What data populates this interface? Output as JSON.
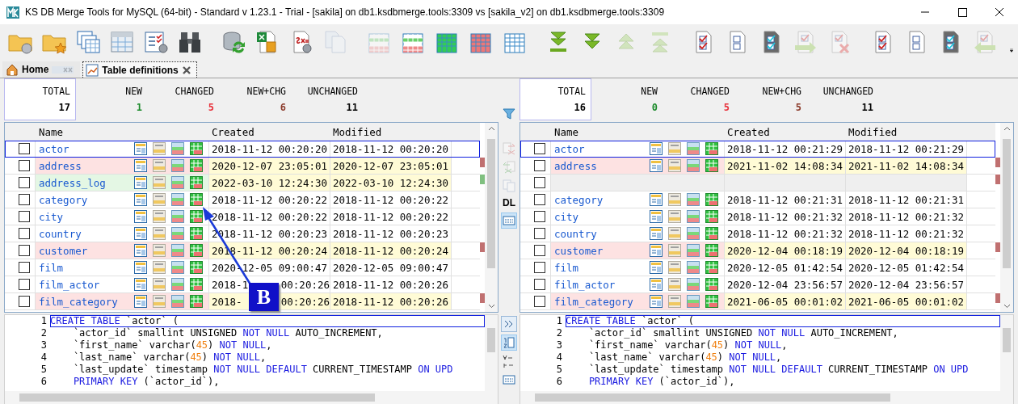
{
  "window": {
    "title": "KS DB Merge Tools for MySQL (64-bit) - Standard v 1.23.1 - Trial - [sakila] on db1.ksdbmerge.tools:3309 vs [sakila_v2] on db1.ksdbmerge.tools:3309"
  },
  "toolbar": [
    {
      "kind": "folder",
      "disabled": false
    },
    {
      "kind": "folder-star",
      "disabled": false
    },
    {
      "kind": "tables",
      "disabled": false
    },
    {
      "kind": "select-table",
      "disabled": false
    },
    {
      "kind": "checklist",
      "disabled": false
    },
    {
      "kind": "binoculars",
      "disabled": false
    },
    {
      "kind": "separator"
    },
    {
      "kind": "db-sync",
      "disabled": false
    },
    {
      "kind": "excel-doc",
      "disabled": false
    },
    {
      "kind": "script-doc",
      "disabled": false
    },
    {
      "kind": "copy-doc",
      "disabled": true
    },
    {
      "kind": "separator"
    },
    {
      "kind": "grid-mixed",
      "disabled": true
    },
    {
      "kind": "grid-mixed",
      "disabled": false
    },
    {
      "kind": "grid",
      "color": "#33cc55",
      "disabled": false
    },
    {
      "kind": "grid",
      "color": "#ee7777",
      "disabled": false
    },
    {
      "kind": "grid",
      "color": "#ffffff",
      "disabled": false
    },
    {
      "kind": "separator"
    },
    {
      "kind": "arrows-down-bar",
      "disabled": false
    },
    {
      "kind": "arrows-down",
      "disabled": false
    },
    {
      "kind": "arrows-up",
      "disabled": true
    },
    {
      "kind": "arrows-up-bar",
      "disabled": true
    },
    {
      "kind": "separator"
    },
    {
      "kind": "checked-doc",
      "disabled": false
    },
    {
      "kind": "empty-doc",
      "disabled": false
    },
    {
      "kind": "dark-doc",
      "disabled": false
    },
    {
      "kind": "doc-arrow-right",
      "disabled": true
    },
    {
      "kind": "doc-cross",
      "disabled": true
    },
    {
      "kind": "separator"
    },
    {
      "kind": "checked-doc",
      "disabled": false
    },
    {
      "kind": "empty-doc",
      "disabled": false
    },
    {
      "kind": "dark-doc",
      "disabled": false
    },
    {
      "kind": "doc-arrow-left",
      "disabled": true
    },
    {
      "kind": "overflow",
      "disabled": false
    }
  ],
  "tabs": [
    {
      "label": "Home",
      "selected": false
    },
    {
      "label": "Table definitions",
      "selected": true
    }
  ],
  "panels": [
    {
      "summary": [
        {
          "label": "TOTAL",
          "value": "17",
          "color": "#000000",
          "selected": true
        },
        {
          "label": "NEW",
          "value": "1",
          "color": "#1a8a2a",
          "selected": false
        },
        {
          "label": "CHANGED",
          "value": "5",
          "color": "#e8303a",
          "selected": false
        },
        {
          "label": "NEW+CHG",
          "value": "6",
          "color": "#8b3a2a",
          "selected": false
        },
        {
          "label": "UNCHANGED",
          "value": "11",
          "color": "#000000",
          "selected": false
        }
      ],
      "columns": [
        "Name",
        "Created",
        "Modified"
      ],
      "rows": [
        {
          "name": "actor",
          "created": "2018-11-12 00:20:20",
          "modified": "2018-11-12 00:20:20",
          "kind": "unchanged",
          "checked": false,
          "selected": true
        },
        {
          "name": "address",
          "created": "2020-12-07 23:05:01",
          "modified": "2020-12-07 23:05:01",
          "kind": "changed",
          "checked": false,
          "selected": false
        },
        {
          "name": "address_log",
          "created": "2022-03-10 12:24:30",
          "modified": "2022-03-10 12:24:30",
          "kind": "new",
          "checked": false,
          "selected": false
        },
        {
          "name": "category",
          "created": "2018-11-12 00:20:22",
          "modified": "2018-11-12 00:20:22",
          "kind": "unchanged",
          "checked": false,
          "selected": false
        },
        {
          "name": "city",
          "created": "2018-11-12 00:20:22",
          "modified": "2018-11-12 00:20:22",
          "kind": "unchanged",
          "checked": false,
          "selected": false
        },
        {
          "name": "country",
          "created": "2018-11-12 00:20:23",
          "modified": "2018-11-12 00:20:23",
          "kind": "unchanged",
          "checked": false,
          "selected": false
        },
        {
          "name": "customer",
          "created": "2018-11-12 00:20:24",
          "modified": "2018-11-12 00:20:24",
          "kind": "changed",
          "checked": false,
          "selected": false
        },
        {
          "name": "film",
          "created": "2020-12-05 09:00:47",
          "modified": "2020-12-05 09:00:47",
          "kind": "unchanged",
          "checked": false,
          "selected": false
        },
        {
          "name": "film_actor",
          "created": "2018-1",
          "created_tail": "00:20:26",
          "modified": "2018-11-12 00:20:26",
          "kind": "unchanged",
          "checked": false,
          "selected": false
        },
        {
          "name": "film_category",
          "created": "2018-",
          "created_tail": "00:20:26",
          "modified": "2018-11-12 00:20:26",
          "kind": "changed",
          "checked": false,
          "selected": false
        }
      ],
      "editor": {
        "lines": [
          {
            "number": "1",
            "tokens": [
              {
                "kind": "keyword",
                "text": "CREATE TABLE"
              },
              {
                "kind": "plain",
                "text": " `actor` ("
              }
            ]
          },
          {
            "number": "2",
            "tokens": [
              {
                "kind": "plain",
                "text": "    `actor_id` smallint UNSIGNED "
              },
              {
                "kind": "keyword",
                "text": "NOT NULL"
              },
              {
                "kind": "plain",
                "text": " AUTO_INCREMENT,"
              }
            ]
          },
          {
            "number": "3",
            "tokens": [
              {
                "kind": "plain",
                "text": "    `first_name` varchar("
              },
              {
                "kind": "number",
                "text": "45"
              },
              {
                "kind": "plain",
                "text": ") "
              },
              {
                "kind": "keyword",
                "text": "NOT NULL"
              },
              {
                "kind": "plain",
                "text": ","
              }
            ]
          },
          {
            "number": "4",
            "tokens": [
              {
                "kind": "plain",
                "text": "    `last_name` varchar("
              },
              {
                "kind": "number",
                "text": "45"
              },
              {
                "kind": "plain",
                "text": ") "
              },
              {
                "kind": "keyword",
                "text": "NOT NULL"
              },
              {
                "kind": "plain",
                "text": ","
              }
            ]
          },
          {
            "number": "5",
            "tokens": [
              {
                "kind": "plain",
                "text": "    `last_update` timestamp "
              },
              {
                "kind": "keyword",
                "text": "NOT NULL DEFAULT"
              },
              {
                "kind": "plain",
                "text": " CURRENT_TIMESTAMP "
              },
              {
                "kind": "keyword",
                "text": "ON UPD"
              }
            ]
          },
          {
            "number": "6",
            "tokens": [
              {
                "kind": "keyword",
                "text": "    PRIMARY KEY"
              },
              {
                "kind": "plain",
                "text": " (`actor_id`),"
              }
            ]
          }
        ]
      }
    },
    {
      "summary": [
        {
          "label": "TOTAL",
          "value": "16",
          "color": "#000000",
          "selected": true
        },
        {
          "label": "NEW",
          "value": "0",
          "color": "#1a8a2a",
          "selected": false
        },
        {
          "label": "CHANGED",
          "value": "5",
          "color": "#e8303a",
          "selected": false
        },
        {
          "label": "NEW+CHG",
          "value": "5",
          "color": "#8b3a2a",
          "selected": false
        },
        {
          "label": "UNCHANGED",
          "value": "11",
          "color": "#000000",
          "selected": false
        }
      ],
      "columns": [
        "Name",
        "Created",
        "Modified"
      ],
      "rows": [
        {
          "name": "actor",
          "created": "2018-11-12 00:21:29",
          "modified": "2018-11-12 00:21:29",
          "kind": "unchanged",
          "checked": false,
          "selected": true
        },
        {
          "name": "address",
          "created": "2021-11-02 14:08:34",
          "modified": "2021-11-02 14:08:34",
          "kind": "changed",
          "checked": false,
          "selected": false
        },
        {
          "kind": "missing",
          "checked": false,
          "selected": false
        },
        {
          "name": "category",
          "created": "2018-11-12 00:21:31",
          "modified": "2018-11-12 00:21:31",
          "kind": "unchanged",
          "checked": false,
          "selected": false
        },
        {
          "name": "city",
          "created": "2018-11-12 00:21:32",
          "modified": "2018-11-12 00:21:32",
          "kind": "unchanged",
          "checked": false,
          "selected": false
        },
        {
          "name": "country",
          "created": "2018-11-12 00:21:32",
          "modified": "2018-11-12 00:21:32",
          "kind": "unchanged",
          "checked": false,
          "selected": false
        },
        {
          "name": "customer",
          "created": "2020-12-04 00:18:19",
          "modified": "2020-12-04 00:18:19",
          "kind": "changed",
          "checked": false,
          "selected": false
        },
        {
          "name": "film",
          "created": "2020-12-05 01:42:54",
          "modified": "2020-12-05 01:42:54",
          "kind": "unchanged",
          "checked": false,
          "selected": false
        },
        {
          "name": "film_actor",
          "created": "2020-12-04 23:56:57",
          "modified": "2020-12-04 23:56:57",
          "kind": "unchanged",
          "checked": false,
          "selected": false
        },
        {
          "name": "film_category",
          "created": "2021-06-05 00:01:02",
          "modified": "2021-06-05 00:01:02",
          "kind": "changed",
          "checked": false,
          "selected": false
        }
      ],
      "editor": {
        "lines": [
          {
            "number": "1",
            "tokens": [
              {
                "kind": "keyword",
                "text": "CREATE TABLE"
              },
              {
                "kind": "plain",
                "text": " `actor` ("
              }
            ]
          },
          {
            "number": "2",
            "tokens": [
              {
                "kind": "plain",
                "text": "    `actor_id` smallint UNSIGNED "
              },
              {
                "kind": "keyword",
                "text": "NOT NULL"
              },
              {
                "kind": "plain",
                "text": " AUTO_INCREMENT,"
              }
            ]
          },
          {
            "number": "3",
            "tokens": [
              {
                "kind": "plain",
                "text": "    `first_name` varchar("
              },
              {
                "kind": "number",
                "text": "45"
              },
              {
                "kind": "plain",
                "text": ") "
              },
              {
                "kind": "keyword",
                "text": "NOT NULL"
              },
              {
                "kind": "plain",
                "text": ","
              }
            ]
          },
          {
            "number": "4",
            "tokens": [
              {
                "kind": "plain",
                "text": "    `last_name` varchar("
              },
              {
                "kind": "number",
                "text": "45"
              },
              {
                "kind": "plain",
                "text": ") "
              },
              {
                "kind": "keyword",
                "text": "NOT NULL"
              },
              {
                "kind": "plain",
                "text": ","
              }
            ]
          },
          {
            "number": "5",
            "tokens": [
              {
                "kind": "plain",
                "text": "    `last_update` timestamp "
              },
              {
                "kind": "keyword",
                "text": "NOT NULL DEFAULT"
              },
              {
                "kind": "plain",
                "text": " CURRENT_TIMESTAMP "
              },
              {
                "kind": "keyword",
                "text": "ON UPD"
              }
            ]
          },
          {
            "number": "6",
            "tokens": [
              {
                "kind": "keyword",
                "text": "    PRIMARY KEY"
              },
              {
                "kind": "plain",
                "text": " (`actor_id`),"
              }
            ]
          }
        ]
      }
    }
  ],
  "middle": {
    "label": "DL"
  },
  "callout": {
    "label": "B"
  }
}
